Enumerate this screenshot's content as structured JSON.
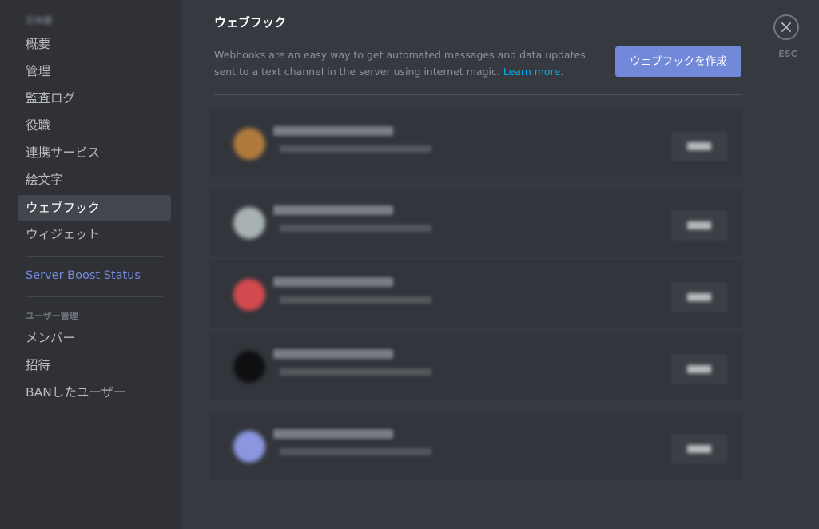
{
  "sidebar": {
    "server_name": "日本語",
    "items": [
      {
        "label": "概要"
      },
      {
        "label": "管理"
      },
      {
        "label": "監査ログ"
      },
      {
        "label": "役職"
      },
      {
        "label": "連携サービス"
      },
      {
        "label": "絵文字"
      },
      {
        "label": "ウェブフック",
        "active": true
      },
      {
        "label": "ウィジェット"
      }
    ],
    "boost_label": "Server Boost Status",
    "user_section": {
      "header": "ユーザー管理",
      "items": [
        {
          "label": "メンバー"
        },
        {
          "label": "招待"
        },
        {
          "label": "BANしたユーザー"
        }
      ]
    }
  },
  "main": {
    "title": "ウェブフック",
    "description": "Webhooks are an easy way to get automated messages and data updates sent to a text channel in the server using internet magic.",
    "learn_more": "Learn more",
    "period": ".",
    "create_button": "ウェブフックを作成",
    "webhooks": [
      {
        "avatar_color": "#b07a3c",
        "name": "",
        "meta": ""
      },
      {
        "avatar_color": "#a9b2b3",
        "name": "",
        "meta": ""
      },
      {
        "avatar_color": "#d24a4e",
        "name": "",
        "meta": ""
      },
      {
        "avatar_color": "#0e0f11",
        "name": "",
        "meta": ""
      },
      {
        "avatar_color": "#8a97e0",
        "name": "",
        "meta": ""
      }
    ]
  },
  "close": {
    "label": "ESC",
    "icon": "close-icon"
  },
  "colors": {
    "accent": "#7289da",
    "link": "#00b0f4",
    "background": "#36393f",
    "sidebar": "#2f3136"
  }
}
